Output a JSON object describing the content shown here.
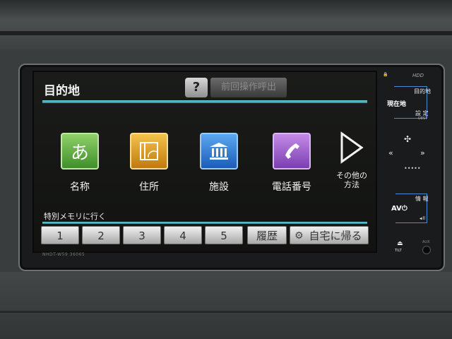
{
  "header": {
    "title": "目的地",
    "help_label": "?",
    "previous_label": "前回操作呼出"
  },
  "search_tiles": [
    {
      "label": "名称",
      "icon": "hiragana-a-icon",
      "glyph": "あ"
    },
    {
      "label": "住所",
      "icon": "map-icon"
    },
    {
      "label": "施設",
      "icon": "building-icon"
    },
    {
      "label": "電話番号",
      "icon": "phone-icon"
    },
    {
      "label": "その他の\n方法",
      "icon": "play-triangle-icon"
    }
  ],
  "memory": {
    "label": "特別メモリに行く",
    "buttons": [
      "1",
      "2",
      "3",
      "4",
      "5"
    ],
    "history_label": "履歴",
    "home_label": "自宅に帰る"
  },
  "device": {
    "model": "NHDT-W59 36065",
    "hdd": "HDD",
    "current_label": "現在地",
    "destination_label": "目的地",
    "setting_label": "設 定",
    "dest_sub": "DEST",
    "info_label": "情 報",
    "av_label": "AV",
    "tilt_label": "TILT",
    "aux_label": "AUX"
  },
  "colors": {
    "accent_line": "#4fc3cc",
    "side_bracket": "#4a88d8"
  }
}
